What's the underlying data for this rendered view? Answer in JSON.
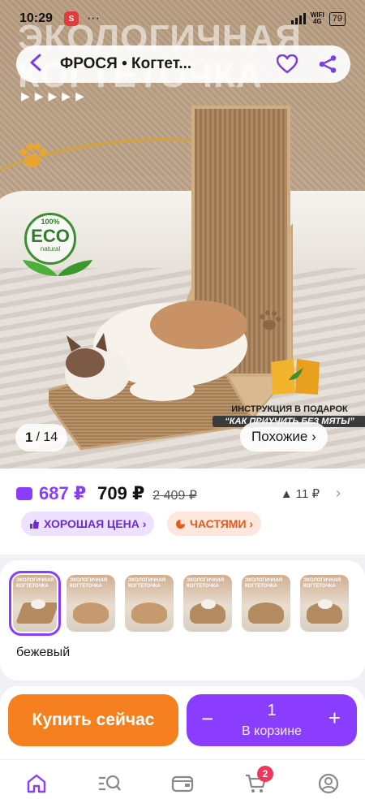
{
  "status_bar": {
    "time": "10:29",
    "app_icon": "S",
    "more": "···",
    "network": "WIFI",
    "network_sub": "4G",
    "battery": "79"
  },
  "top_bar": {
    "title": "ФРОСЯ • Когтет...",
    "icons": [
      "back-arrow-icon",
      "heart-icon",
      "share-icon"
    ]
  },
  "hero": {
    "banner_text": [
      "ЭКОЛОГИЧНАЯ",
      "КОГТЕТОЧКА"
    ],
    "arrows": "▶▶▶▶▶",
    "eco_badge": {
      "percent": "100%",
      "word": "ECO",
      "natural": "natural"
    },
    "gift_line1": "ИНСТРУКЦИЯ В ПОДАРОК",
    "gift_line2": "“КАК ПРИУЧИТЬ БЕЗ МЯТЫ”",
    "counter_current": "1",
    "counter_total": "/ 14",
    "similar_label": "Похожие ›"
  },
  "prices": {
    "card_price": "687 ₽",
    "price": "709 ₽",
    "old_price": "2 409 ₽",
    "change": "▲ 11 ₽",
    "chevron": "›"
  },
  "chips": {
    "good_price": "ХОРОШАЯ ЦЕНА ›",
    "installments": "ЧАСТЯМИ ›"
  },
  "variants": {
    "selected_label": "бежевый",
    "thumb_caption": "ЭКОЛОГИЧНАЯ КОГТЕТОЧКА",
    "thumbs": [
      "ramp",
      "wave",
      "wave",
      "curve",
      "curve",
      "curve"
    ]
  },
  "buy": {
    "buy_now": "Купить сейчас",
    "minus": "−",
    "qty": "1",
    "plus": "+",
    "in_cart": "В корзине"
  },
  "nav": {
    "items": [
      "home-icon",
      "catalog-search-icon",
      "wallet-icon",
      "cart-icon",
      "profile-icon"
    ],
    "cart_badge": "2"
  },
  "colors": {
    "accent": "#8b3dff",
    "buy_orange": "#f6801f",
    "badge_red": "#f0365a"
  }
}
